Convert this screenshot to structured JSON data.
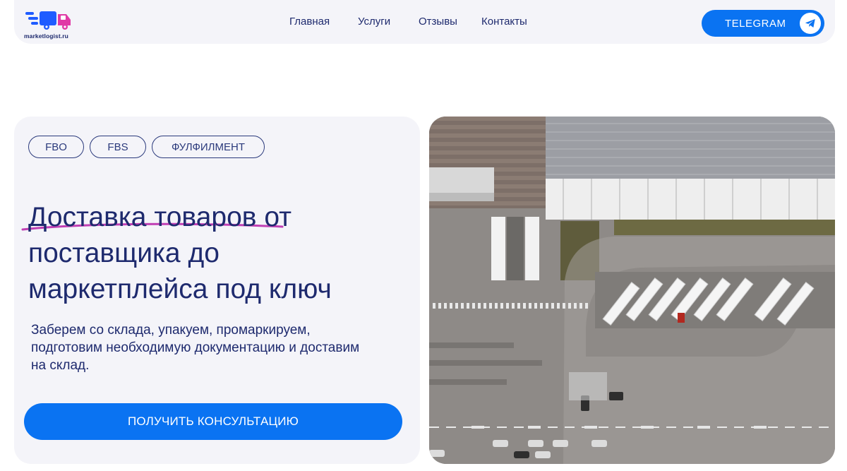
{
  "header": {
    "logo_text": "marketlogist.ru",
    "nav": [
      {
        "label": "Главная"
      },
      {
        "label": "Услуги"
      },
      {
        "label": "Отзывы"
      },
      {
        "label": "Контакты"
      }
    ],
    "telegram_button": "TELEGRAM"
  },
  "hero": {
    "tags": [
      "FBO",
      "FBS",
      "ФУЛФИЛМЕНТ"
    ],
    "title_line1": "Доставка товаров от",
    "title_line2": "поставщика до",
    "title_line3": "маркетплейса под ключ",
    "description": "Заберем со склада, упакуем, промаркируем, подготовим необходимую документацию и доставим на склад.",
    "cta_label": "ПОЛУЧИТЬ КОНСУЛЬТАЦИЮ"
  },
  "colors": {
    "accent": "#0a73f2",
    "text": "#1e2a6e",
    "card_bg": "#f4f4f9",
    "underline": "#c03fb4",
    "logo_pink": "#e03aa6",
    "logo_blue": "#1f5cff"
  },
  "icons": {
    "logo": "delivery-truck-logo",
    "telegram": "telegram-icon"
  }
}
